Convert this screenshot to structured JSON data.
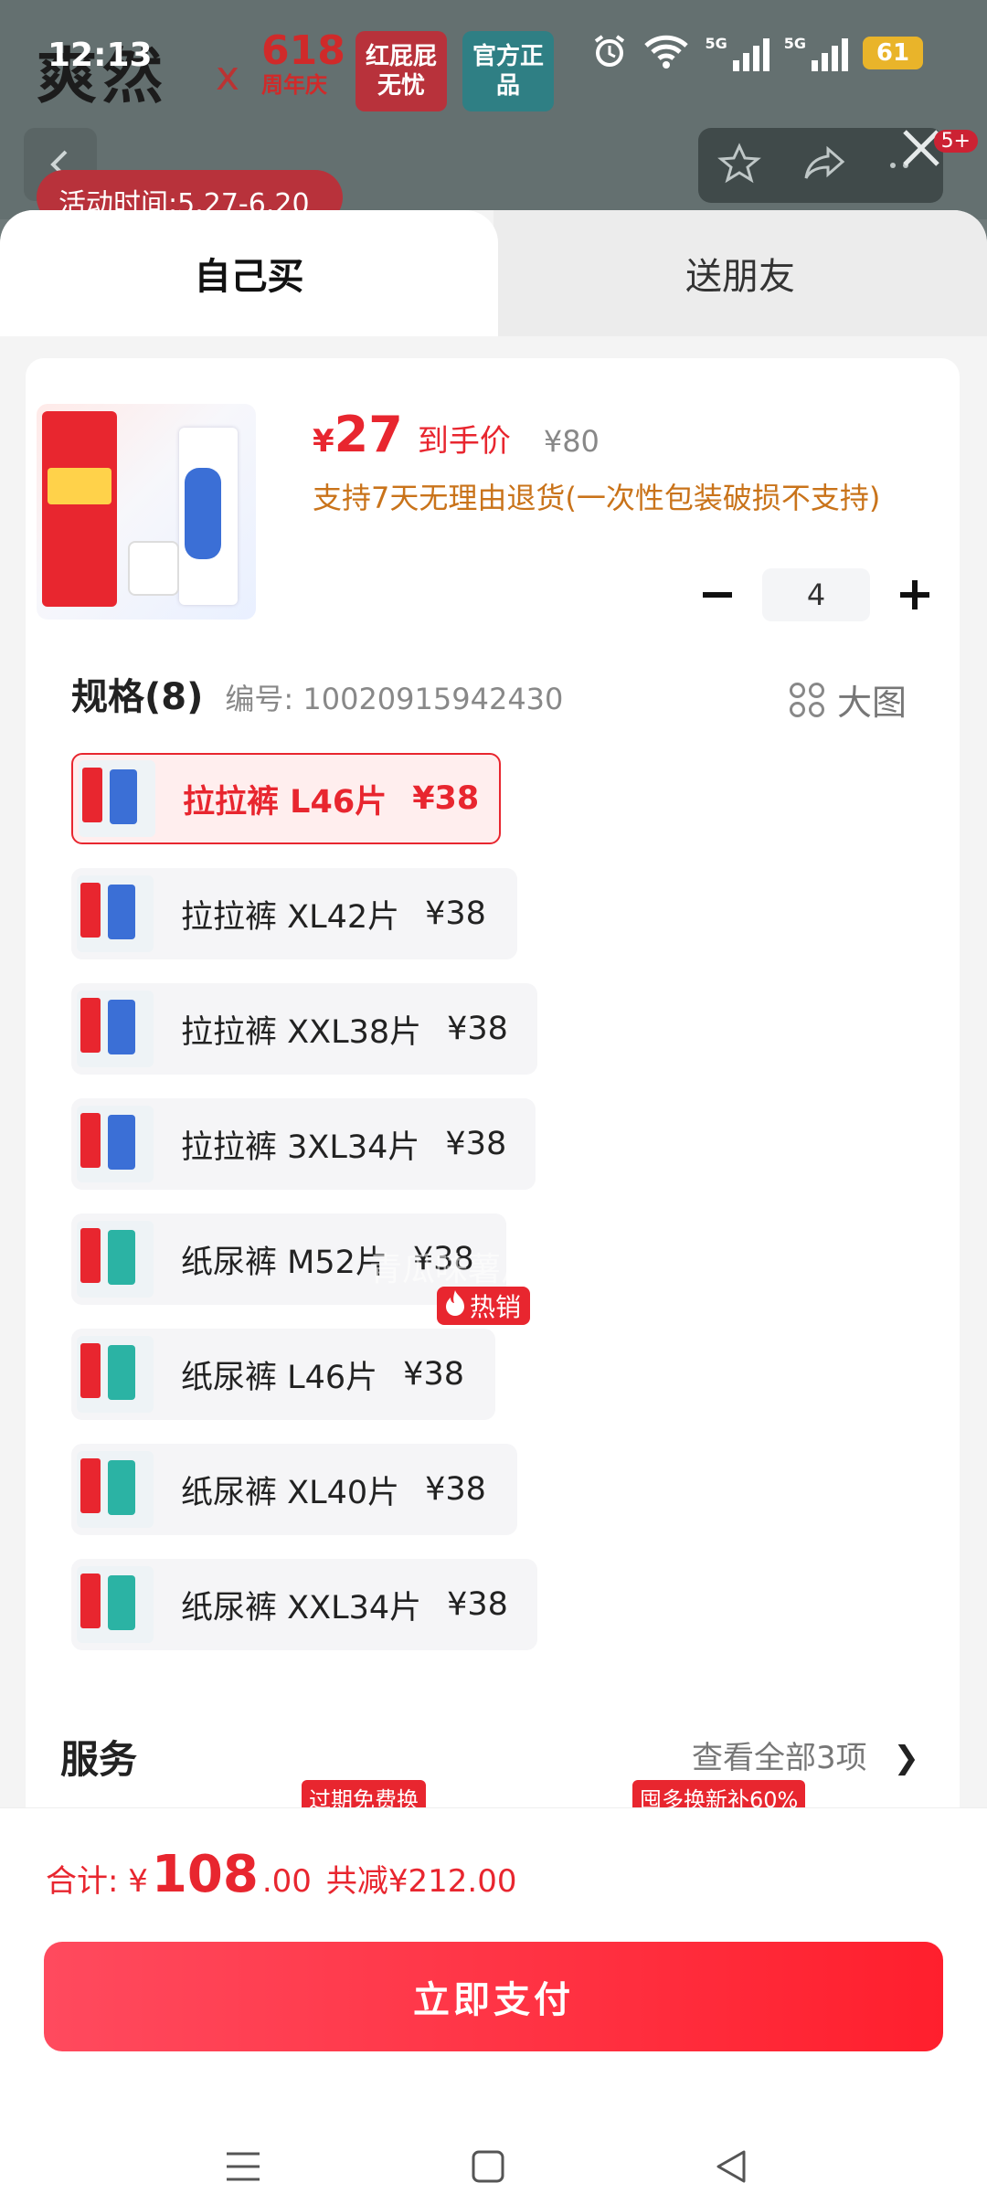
{
  "status": {
    "time": "12:13",
    "net1": "5G",
    "net2": "5G",
    "battery": "61"
  },
  "background": {
    "brand": "爽然",
    "brand_x": "x",
    "brand_618": "618",
    "brand_618_sub": "周年庆",
    "badge1": "红屁屁无忧",
    "badge2": "官方正品",
    "activity": "活动时间:5.27-6.20",
    "notif_badge": "5+"
  },
  "tabs": {
    "self": "自己买",
    "friend": "送朋友"
  },
  "product": {
    "price_symbol": "¥",
    "price": "27",
    "price_label": "到手价",
    "original_price": "¥80",
    "return_note": "支持7天无理由退货(一次性包装破损不支持)",
    "quantity": "4"
  },
  "spec": {
    "title": "规格(8)",
    "sku": "编号: 10020915942430",
    "big_image": "大图",
    "hot_tag": "热销",
    "options": [
      {
        "label": "拉拉裤 L46片",
        "price": "¥38",
        "selected": true
      },
      {
        "label": "拉拉裤 XL42片",
        "price": "¥38"
      },
      {
        "label": "拉拉裤 XXL38片",
        "price": "¥38"
      },
      {
        "label": "拉拉裤 3XL34片",
        "price": "¥38"
      },
      {
        "label": "纸尿裤 M52片",
        "price": "¥38"
      },
      {
        "label": "纸尿裤 L46片",
        "price": "¥38"
      },
      {
        "label": "纸尿裤 XL40片",
        "price": "¥38"
      },
      {
        "label": "纸尿裤 XXL34片",
        "price": "¥38"
      }
    ]
  },
  "watermark": "青瓜味薯片",
  "services": {
    "title": "服务",
    "more": "查看全部3项",
    "tag1": "过期免费换",
    "tag2": "囤多换新补60%"
  },
  "footer": {
    "total_label": "合计: ¥",
    "total_int": "108",
    "total_dec": ".00",
    "saved": "共减¥212.00",
    "pay": "立即支付"
  },
  "colors": {
    "accent": "#e8262f",
    "note": "#c9731a",
    "pay_start": "#ff4a5e",
    "pay_end": "#ff1f2d"
  }
}
